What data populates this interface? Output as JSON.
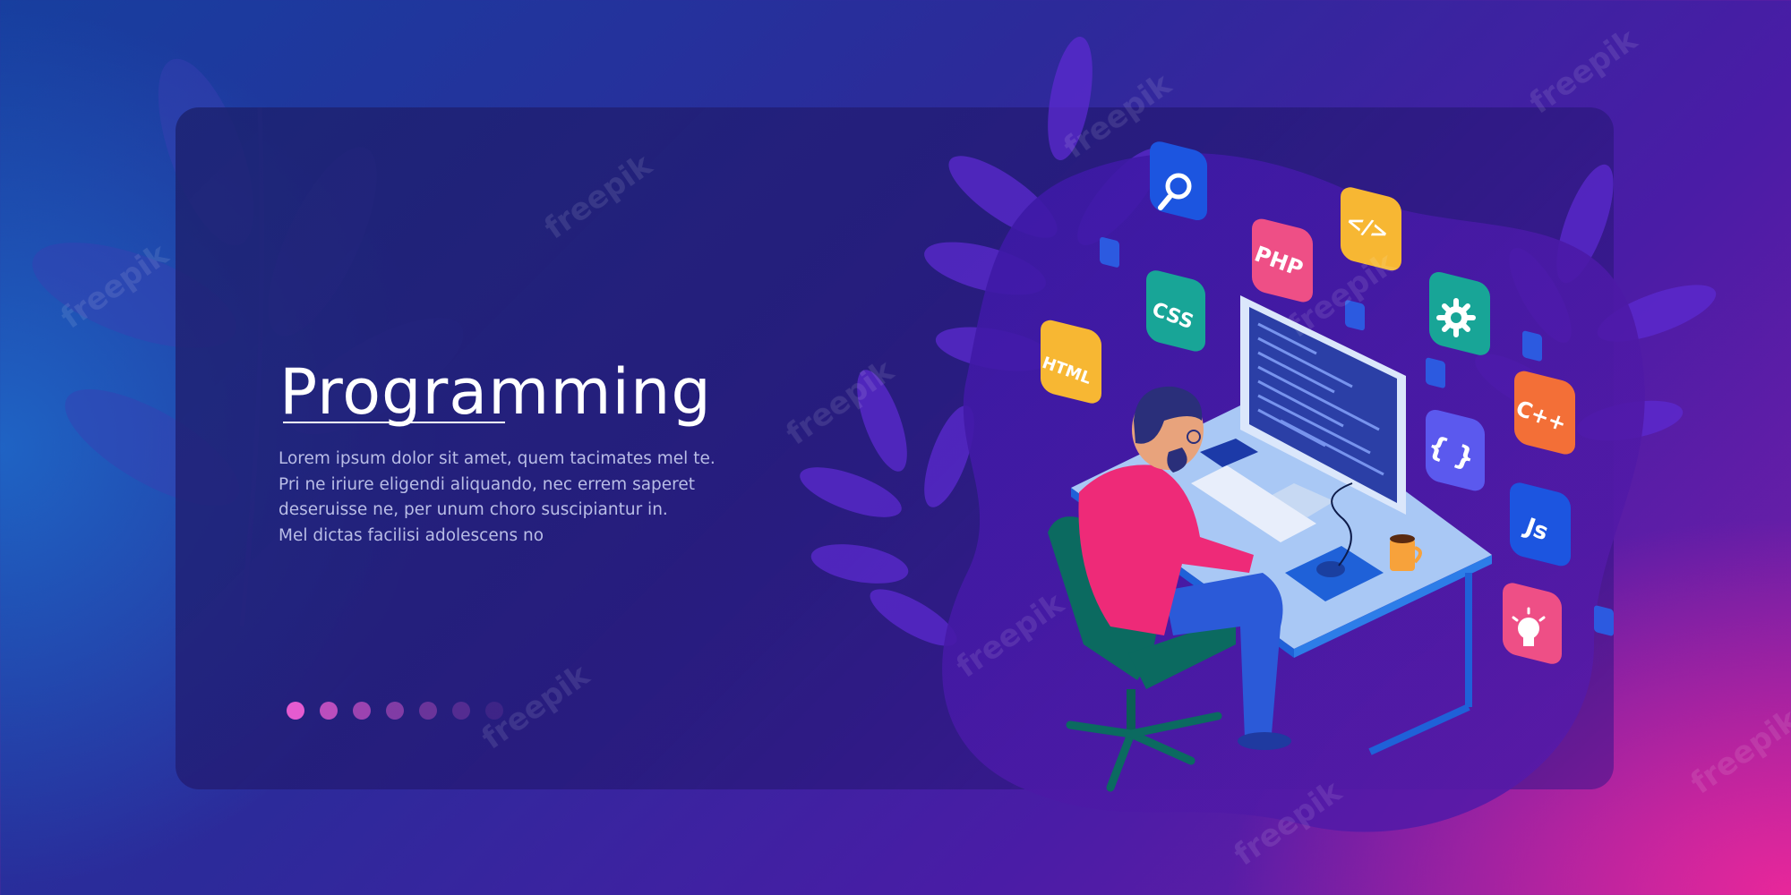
{
  "hero": {
    "title": "Programming",
    "description_lines": [
      "Lorem ipsum dolor sit amet, quem tacimates mel te.",
      "Pri ne iriure eligendi aliquando, nec errem saperet",
      "deseruisse ne, per unum choro suscipiantur in.",
      "Mel dictas facilisi adolescens no"
    ]
  },
  "carousel": {
    "dot_count": 7,
    "active_index": 0
  },
  "code_icons": {
    "html": "HTML",
    "css": "CSS",
    "php": "PHP",
    "tag": "</>",
    "cpp": "C++",
    "braces": "{ }",
    "js": "Js",
    "search_icon": "search-icon",
    "gear_icon": "gear-icon",
    "lightbulb_icon": "lightbulb-icon"
  },
  "watermark": "freepik",
  "colors": {
    "accent_pink": "#e55bd0",
    "icon_yellow": "#f7b733",
    "icon_teal": "#18a597",
    "icon_pink": "#ee4f86",
    "icon_blue": "#1c55e0",
    "icon_orange": "#f36f37",
    "icon_violet": "#5b59ee"
  }
}
